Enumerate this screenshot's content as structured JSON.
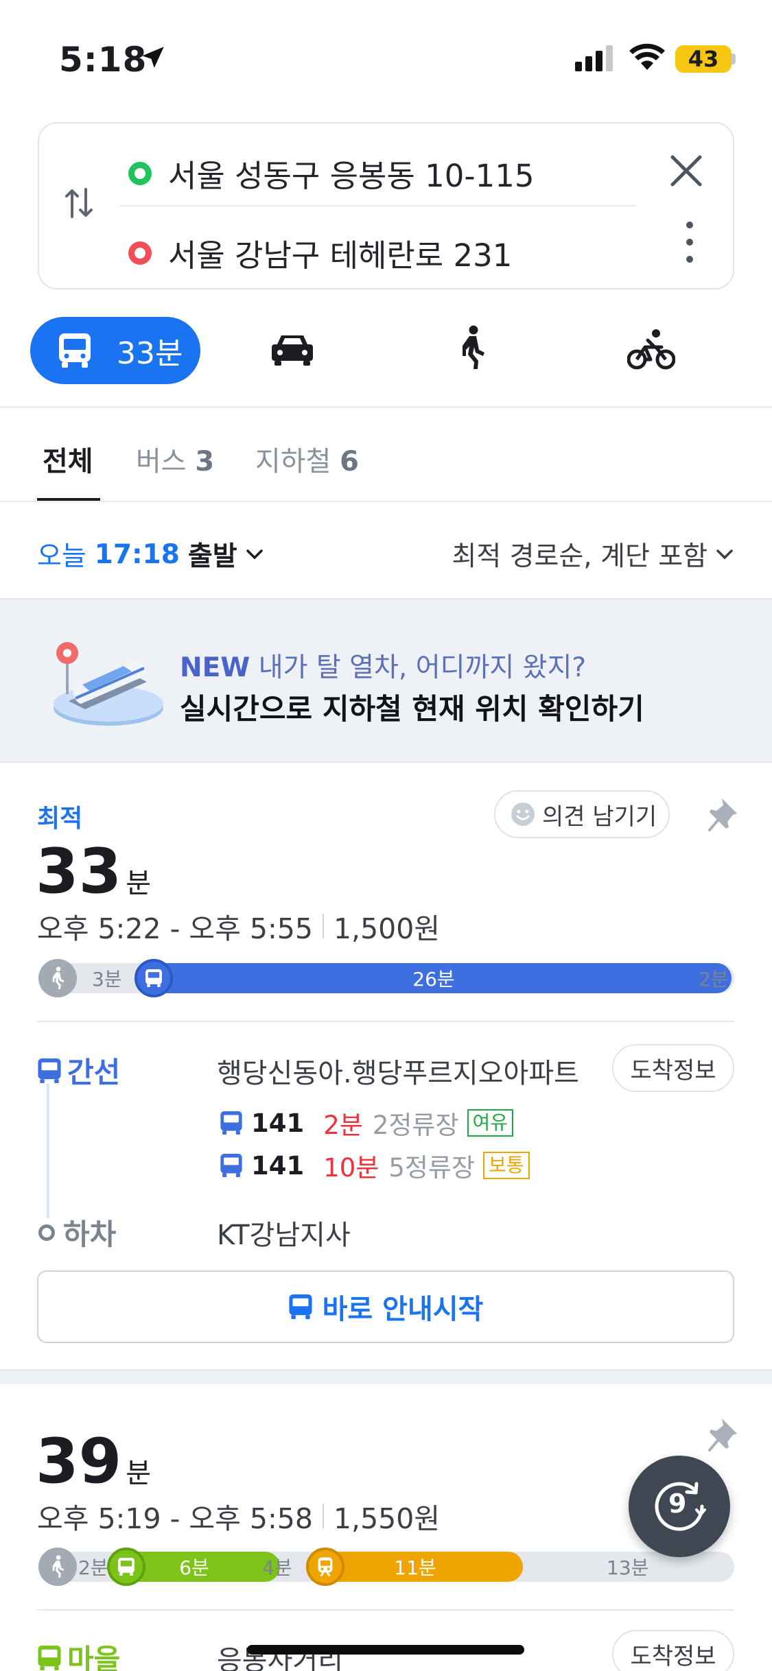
{
  "status": {
    "time": "5:18",
    "battery": "43"
  },
  "route": {
    "start": "서울 성동구 응봉동 10-115",
    "end": "서울 강남구 테헤란로 231"
  },
  "modes": {
    "transit_label": "33분"
  },
  "tabs": {
    "all": "전체",
    "bus_label": "버스",
    "bus_count": "3",
    "subway_label": "지하철",
    "subway_count": "6"
  },
  "options": {
    "today": "오늘",
    "time": "17:18",
    "depart": "출발",
    "sort": "최적 경로순, 계단 포함"
  },
  "banner": {
    "new_tag": "NEW",
    "line1": "내가 탈 열차, 어디까지 왔지?",
    "line2": "실시간으로 지하철 현재 위치 확인하기"
  },
  "colors": {
    "primary": "#1a73f0",
    "trunk_bus": "#3d6fe0",
    "village_bus": "#7cc31a",
    "subway_orange": "#f0a400",
    "start_dot": "#1fc461",
    "end_dot": "#f14e55"
  },
  "results": [
    {
      "tag": "최적",
      "feedback": "의견 남기기",
      "duration": "33",
      "duration_unit": "분",
      "time_range": "오후 5:22 - 오후 5:55",
      "fare": "1,500원",
      "segments": {
        "walk_start": "3분",
        "bus": "26분",
        "walk_end": "2분"
      },
      "legs": {
        "type": "간선",
        "stop": "행당신동아.행당푸르지오아파트",
        "arrival_button": "도착정보",
        "buses": [
          {
            "number": "141",
            "minutes": "2분",
            "stops": "2정류장",
            "crowd": "여유",
            "crowd_color": "#1faa45"
          },
          {
            "number": "141",
            "minutes": "10분",
            "stops": "5정류장",
            "crowd": "보통",
            "crowd_color": "#f0a400"
          }
        ],
        "alight_label": "하차",
        "alight_stop": "KT강남지사"
      },
      "start_button": "바로 안내시작"
    },
    {
      "duration": "39",
      "duration_unit": "분",
      "time_range": "오후 5:19 - 오후 5:58",
      "fare": "1,550원",
      "segments": {
        "walk_start": "2분",
        "village_bus": "6분",
        "walk_mid": "4분",
        "subway": "11분",
        "rest": "13분"
      },
      "legs": {
        "type": "마을",
        "stop": "응봉사거리",
        "arrival_button": "도착정보"
      }
    }
  ],
  "fab": {
    "count": "9"
  }
}
